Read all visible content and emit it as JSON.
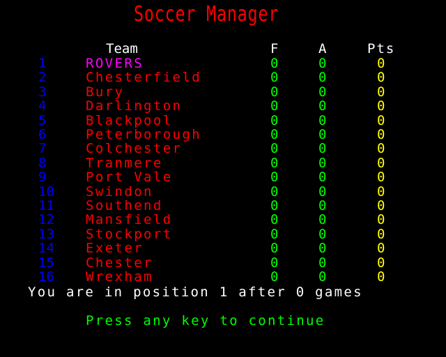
{
  "title": "Soccer Manager",
  "headers": {
    "team": "Team",
    "for": "F",
    "against": "A",
    "points": "Pts"
  },
  "colors": {
    "background": "#000000",
    "title": "#ff0000",
    "position": "#0000ff",
    "team": "#ff0000",
    "player_team": "#ff00ff",
    "goals": "#00ff00",
    "points": "#ffff00",
    "status": "#ffffff",
    "prompt": "#00ff00"
  },
  "table": [
    {
      "pos": "1",
      "team": "ROVERS",
      "f": "0",
      "a": "0",
      "pts": "0",
      "highlight": true
    },
    {
      "pos": "2",
      "team": "Chesterfield",
      "f": "0",
      "a": "0",
      "pts": "0"
    },
    {
      "pos": "3",
      "team": "Bury",
      "f": "0",
      "a": "0",
      "pts": "0"
    },
    {
      "pos": "4",
      "team": "Darlington",
      "f": "0",
      "a": "0",
      "pts": "0"
    },
    {
      "pos": "5",
      "team": "Blackpool",
      "f": "0",
      "a": "0",
      "pts": "0"
    },
    {
      "pos": "6",
      "team": "Peterborough",
      "f": "0",
      "a": "0",
      "pts": "0"
    },
    {
      "pos": "7",
      "team": "Colchester",
      "f": "0",
      "a": "0",
      "pts": "0"
    },
    {
      "pos": "8",
      "team": "Tranmere",
      "f": "0",
      "a": "0",
      "pts": "0"
    },
    {
      "pos": "9",
      "team": "Port Vale",
      "f": "0",
      "a": "0",
      "pts": "0"
    },
    {
      "pos": "10",
      "team": "Swindon",
      "f": "0",
      "a": "0",
      "pts": "0"
    },
    {
      "pos": "11",
      "team": "Southend",
      "f": "0",
      "a": "0",
      "pts": "0"
    },
    {
      "pos": "12",
      "team": "Mansfield",
      "f": "0",
      "a": "0",
      "pts": "0"
    },
    {
      "pos": "13",
      "team": "Stockport",
      "f": "0",
      "a": "0",
      "pts": "0"
    },
    {
      "pos": "14",
      "team": "Exeter",
      "f": "0",
      "a": "0",
      "pts": "0"
    },
    {
      "pos": "15",
      "team": "Chester",
      "f": "0",
      "a": "0",
      "pts": "0"
    },
    {
      "pos": "16",
      "team": "Wrexham",
      "f": "0",
      "a": "0",
      "pts": "0"
    }
  ],
  "status": "You are in position 1 after 0 games",
  "prompt": "Press any key to continue"
}
